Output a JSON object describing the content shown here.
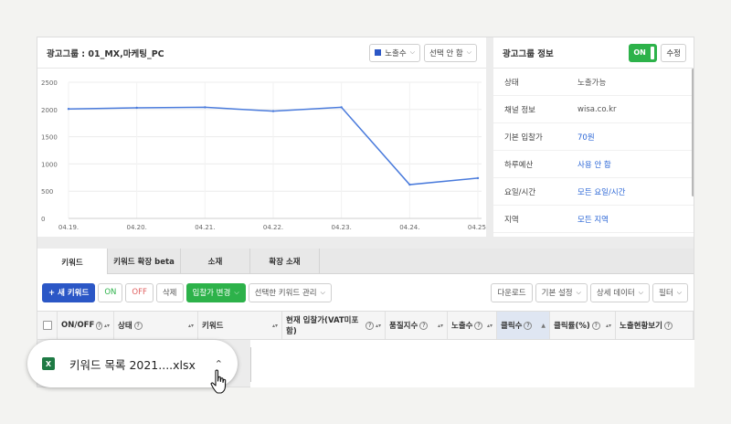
{
  "chart_panel": {
    "title": "광고그룹 : 01_MX,마케팅_PC",
    "metric_select": "노출수",
    "compare_select": "선택 안 함"
  },
  "chart_data": {
    "type": "line",
    "x": [
      "04.19.",
      "04.20.",
      "04.21.",
      "04.22.",
      "04.23.",
      "04.24.",
      "04.25."
    ],
    "series": [
      {
        "values": [
          2010,
          2030,
          2040,
          1970,
          2040,
          620,
          740
        ]
      }
    ],
    "yticks": [
      "0",
      "500",
      "1000",
      "1500",
      "2000",
      "2500"
    ],
    "ylim": [
      0,
      2500
    ],
    "grid": true,
    "color": "#4a7bdc"
  },
  "info_panel": {
    "title": "광고그룹 정보",
    "toggle_label": "ON",
    "edit_label": "수정",
    "rows": [
      {
        "key": "상태",
        "value": "노출가능",
        "link": false
      },
      {
        "key": "채널 정보",
        "value": "wisa.co.kr",
        "link": false
      },
      {
        "key": "기본 입찰가",
        "value": "70원",
        "link": true
      },
      {
        "key": "하루예산",
        "value": "사용 안 함",
        "link": true
      },
      {
        "key": "요일/시간",
        "value": "모든 요일/시간",
        "link": true
      },
      {
        "key": "지역",
        "value": "모든 지역",
        "link": true
      }
    ]
  },
  "tabs": [
    "키워드",
    "키워드 확장 beta",
    "소재",
    "확장 소재"
  ],
  "toolbar": {
    "new_keyword": "+ 새 키워드",
    "on": "ON",
    "off": "OFF",
    "delete": "삭제",
    "bid_change": "입찰가 변경",
    "manage_selected": "선택한 키워드 관리",
    "download": "다운로드",
    "basic_settings": "기본 설정",
    "detail_data": "상세 데이터",
    "filter": "필터"
  },
  "table_headers": [
    {
      "label": "ON/OFF",
      "q": true
    },
    {
      "label": "상태",
      "q": true
    },
    {
      "label": "키워드",
      "q": false
    },
    {
      "label": "현재 입찰가(VAT미포함)",
      "q": true
    },
    {
      "label": "품질지수",
      "q": true
    },
    {
      "label": "노출수",
      "q": true
    },
    {
      "label": "클릭수",
      "q": true
    },
    {
      "label": "클릭률(%)",
      "q": true
    },
    {
      "label": "노출현황보기",
      "q": true
    }
  ],
  "download_bar": {
    "file_name": "키워드 목록 2021....xlsx",
    "file_type_label": "X"
  },
  "colors": {
    "accent_blue": "#2b57c6",
    "on_green": "#2db24a",
    "link_blue": "#2b66d6"
  }
}
